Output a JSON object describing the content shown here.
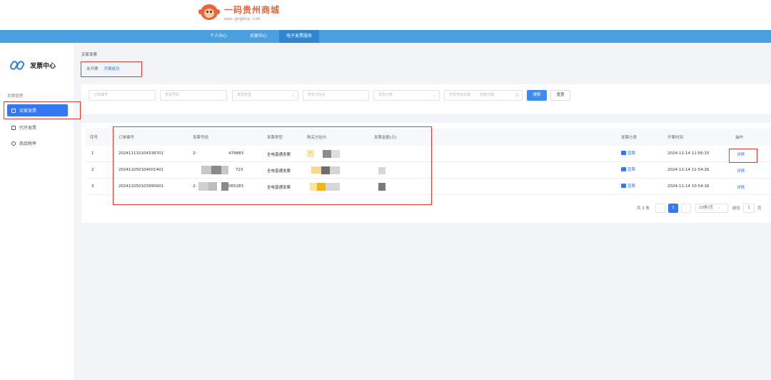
{
  "header": {
    "logo_title": "一码贵州商城",
    "logo_url": "www.gogbuy.com"
  },
  "nav": {
    "items": [
      {
        "label": "个人中心"
      },
      {
        "label": "买家中心"
      },
      {
        "label": "电子发票服务"
      }
    ]
  },
  "sidebar": {
    "title": "发票中心",
    "group_label": "发票管理",
    "items": [
      {
        "label": "买家发票",
        "icon": "document-icon"
      },
      {
        "label": "代开发票",
        "icon": "file-icon"
      },
      {
        "label": "商品税率",
        "icon": "settings-icon"
      }
    ]
  },
  "main": {
    "breadcrumb": "买家发票",
    "tabs": [
      {
        "label": "未开票"
      },
      {
        "label": "开票成功"
      }
    ]
  },
  "filters": {
    "order_no": "订单编号",
    "invoice_no": "发票号码",
    "invoice_type": "发票类型",
    "buyer_title": "购买方抬头",
    "invoice_category": "发票分类",
    "start_date": "开票开始日期",
    "date_sep": "-",
    "end_date": "结束日期",
    "search_btn": "搜索",
    "reset_btn": "重置"
  },
  "table": {
    "headers": {
      "index": "序号",
      "order_no": "订单编号",
      "invoice_no": "发票号码",
      "invoice_type": "发票类型",
      "buyer": "购买方抬头",
      "amount": "发票金额(元)",
      "category": "发票分类",
      "time": "开票时间",
      "action": "操作"
    },
    "rows": [
      {
        "index": "1",
        "order_no": "202411110104338701",
        "invoice_no_prefix": "2-",
        "invoice_no_suffix": "479883",
        "invoice_type": "全电普通发票",
        "buyer_mark": "*",
        "category": "蓝票",
        "time": "2024-11-14 11:56:15",
        "action": "详情"
      },
      {
        "index": "2",
        "order_no": "202411050104001401",
        "invoice_no_prefix": "",
        "invoice_no_suffix": "723",
        "invoice_type": "全电普通发票",
        "buyer_mark": "",
        "category": "蓝票",
        "time": "2024-11-14 11:54:26",
        "action": "详情"
      },
      {
        "index": "3",
        "order_no": "202411050103995601",
        "invoice_no_prefix": "2-",
        "invoice_no_suffix": "065283",
        "invoice_type": "全电普通发票",
        "buyer_mark": "",
        "category": "蓝票",
        "time": "2024-11-14 10:54:16",
        "action": "详情"
      }
    ]
  },
  "pagination": {
    "total": "共 3 条",
    "prev": "‹",
    "current": "1",
    "next": "›",
    "page_size": "10条/页",
    "goto_label": "前往",
    "goto_value": "1",
    "goto_suffix": "页"
  },
  "colors": {
    "accent": "#3478f6",
    "nav": "#4a9fe0",
    "highlight": "#e53935",
    "logo": "#e8643a"
  }
}
